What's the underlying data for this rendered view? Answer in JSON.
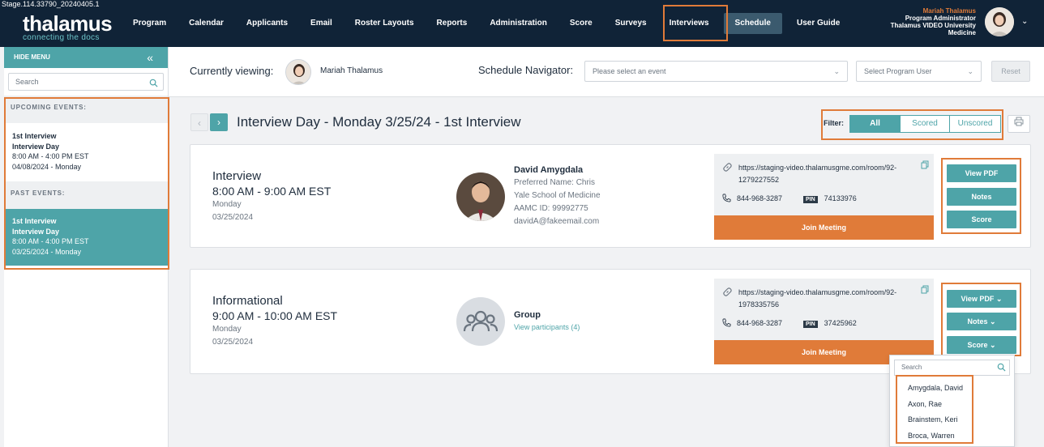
{
  "build": "Stage.114.33790_20240405.1",
  "logo": {
    "name": "thalamus",
    "tagline": "connecting the docs"
  },
  "nav": {
    "items": [
      "Program",
      "Calendar",
      "Applicants",
      "Email",
      "Roster Layouts",
      "Reports",
      "Administration",
      "Score",
      "Surveys",
      "Interviews",
      "Schedule",
      "User Guide"
    ],
    "active": "Schedule"
  },
  "user": {
    "name": "Mariah Thalamus",
    "role": "Program Administrator",
    "org_line1": "Thalamus VIDEO University",
    "org_line2": "Medicine",
    "avatar_icon": "user-avatar-photo"
  },
  "sidebar": {
    "hide_menu": "HIDE MENU",
    "search_placeholder": "Search",
    "upcoming_header": "UPCOMING EVENTS:",
    "past_header": "PAST EVENTS:",
    "upcoming": [
      {
        "title": "1st Interview",
        "subtitle": "Interview Day",
        "time": "8:00 AM - 4:00 PM EST",
        "date": "04/08/2024 - Monday"
      }
    ],
    "past": [
      {
        "title": "1st Interview",
        "subtitle": "Interview Day",
        "time": "8:00 AM - 4:00 PM EST",
        "date": "03/25/2024 - Monday"
      }
    ]
  },
  "viewing": {
    "label": "Currently viewing:",
    "name": "Mariah Thalamus",
    "navigator_label": "Schedule Navigator:",
    "event_placeholder": "Please select an event",
    "user_placeholder": "Select Program User",
    "reset": "Reset"
  },
  "day": {
    "title": "Interview Day - Monday 3/25/24 - 1st Interview",
    "filter_label": "Filter:",
    "filters": [
      "All",
      "Scored",
      "Unscored"
    ],
    "active_filter": "All"
  },
  "cards": [
    {
      "type": "Interview",
      "time": "8:00 AM - 9:00 AM EST",
      "dow": "Monday",
      "date": "03/25/2024",
      "applicant": {
        "name": "David Amygdala",
        "preferred": "Preferred Name: Chris",
        "school": "Yale School of Medicine",
        "aamc": "AAMC ID: 99992775",
        "email": "davidA@fakeemail.com"
      },
      "meeting": {
        "url": "https://staging-video.thalamusgme.com/room/92-1279227552",
        "phone": "844-968-3287",
        "pin_label": "PIN",
        "pin": "74133976",
        "join": "Join Meeting"
      },
      "actions": [
        "View PDF",
        "Notes",
        "Score"
      ]
    },
    {
      "type": "Informational",
      "time": "9:00 AM - 10:00 AM EST",
      "dow": "Monday",
      "date": "03/25/2024",
      "group": {
        "name": "Group",
        "link": "View participants (4)"
      },
      "meeting": {
        "url": "https://staging-video.thalamusgme.com/room/92-1978335756",
        "phone": "844-968-3287",
        "pin_label": "PIN",
        "pin": "37425962",
        "join": "Join Meeting"
      },
      "actions": [
        "View PDF",
        "Notes",
        "Score"
      ]
    }
  ],
  "score_dropdown": {
    "search_placeholder": "Search",
    "items": [
      "Amygdala, David",
      "Axon, Rae",
      "Brainstem, Keri",
      "Broca, Warren"
    ]
  },
  "colors": {
    "navy": "#102337",
    "teal": "#4ea4a8",
    "orange": "#e07b39"
  }
}
